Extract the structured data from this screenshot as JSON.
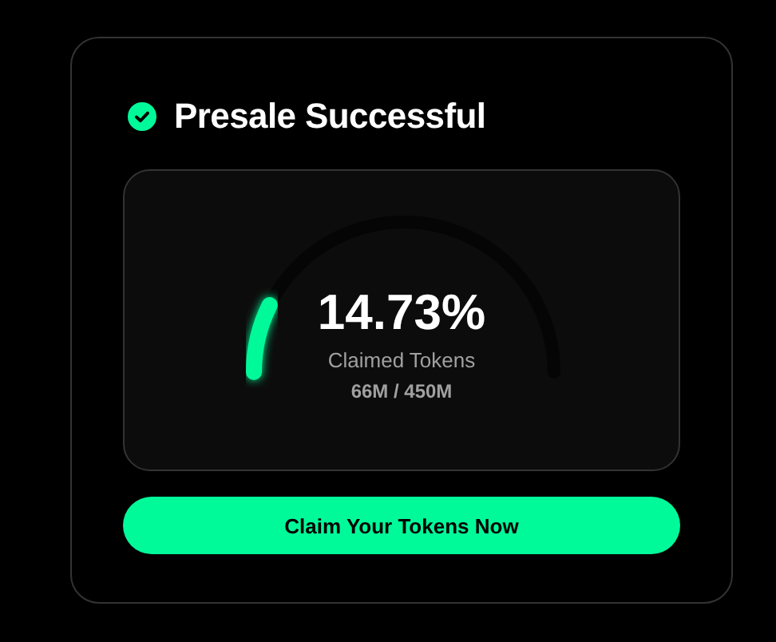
{
  "card": {
    "title": "Presale Successful"
  },
  "progress": {
    "percentage": "14.73%",
    "label": "Claimed Tokens",
    "amount": "66M / 450M"
  },
  "button": {
    "label": "Claim Your Tokens Now"
  }
}
